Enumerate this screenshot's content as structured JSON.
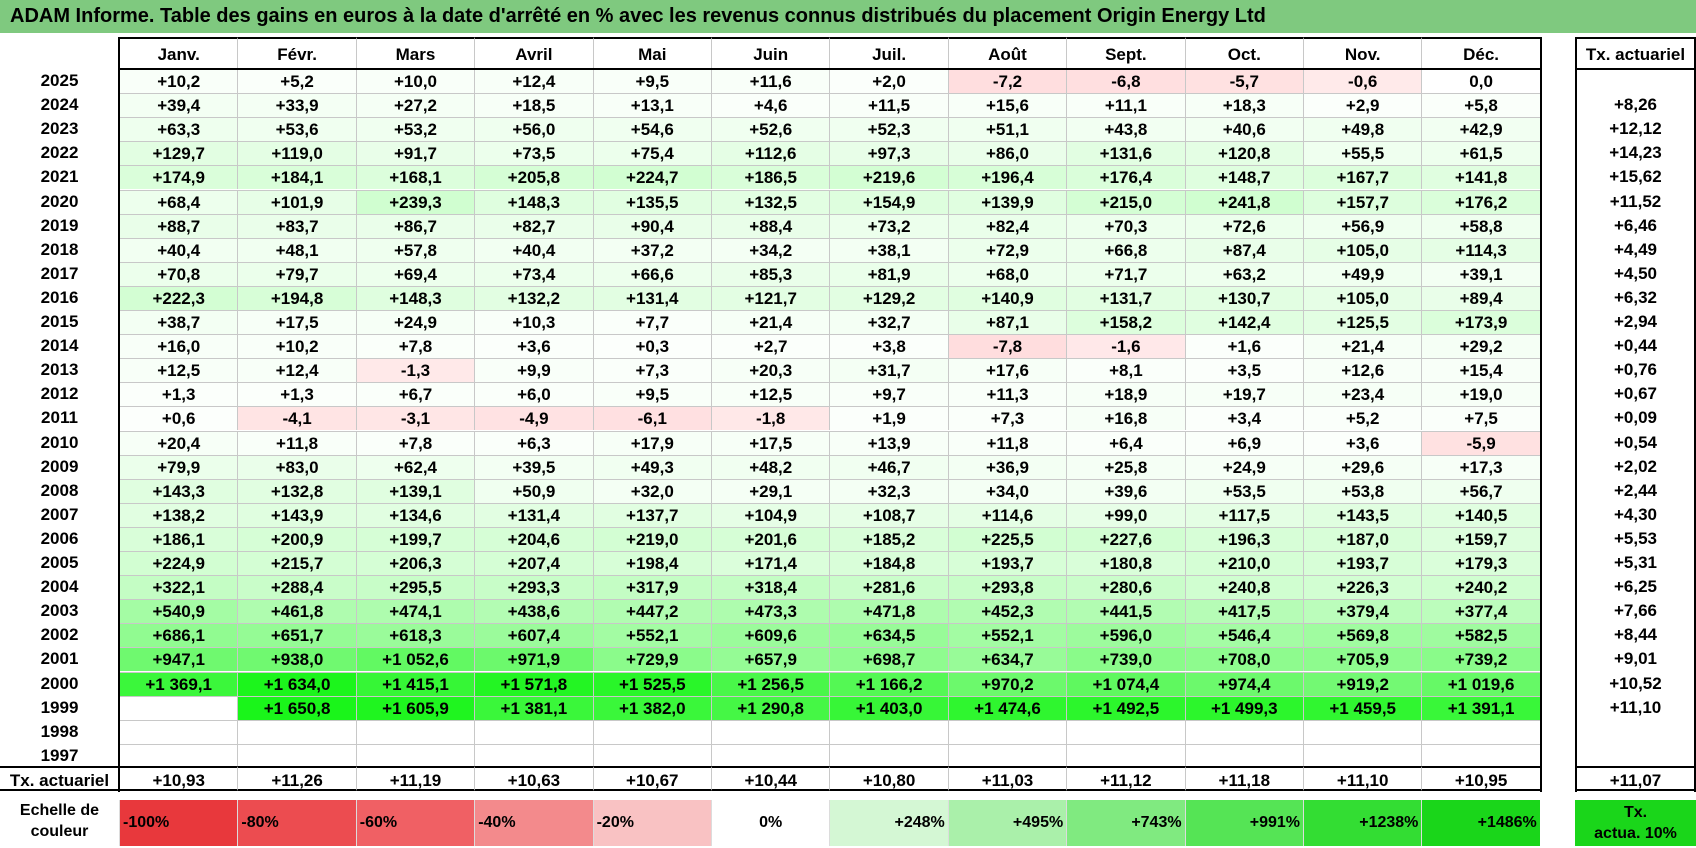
{
  "title": "ADAM Informe. Table des gains en euros à la date d'arrêté en % avec les revenus connus distribués du placement Origin Energy Ltd",
  "chart_data": {
    "type": "table",
    "months": [
      "Janv.",
      "Févr.",
      "Mars",
      "Avril",
      "Mai",
      "Juin",
      "Juil.",
      "Août",
      "Sept.",
      "Oct.",
      "Nov.",
      "Déc."
    ],
    "rate_header": "Tx. actuariel",
    "rows": [
      {
        "year": "2025",
        "values": [
          "+10,2",
          "+5,2",
          "+10,0",
          "+12,4",
          "+9,5",
          "+11,6",
          "+2,0",
          "-7,2",
          "-6,8",
          "-5,7",
          "-0,6",
          "0,0"
        ],
        "rate": ""
      },
      {
        "year": "2024",
        "values": [
          "+39,4",
          "+33,9",
          "+27,2",
          "+18,5",
          "+13,1",
          "+4,6",
          "+11,5",
          "+15,6",
          "+11,1",
          "+18,3",
          "+2,9",
          "+5,8"
        ],
        "rate": "+8,26"
      },
      {
        "year": "2023",
        "values": [
          "+63,3",
          "+53,6",
          "+53,2",
          "+56,0",
          "+54,6",
          "+52,6",
          "+52,3",
          "+51,1",
          "+43,8",
          "+40,6",
          "+49,8",
          "+42,9"
        ],
        "rate": "+12,12"
      },
      {
        "year": "2022",
        "values": [
          "+129,7",
          "+119,0",
          "+91,7",
          "+73,5",
          "+75,4",
          "+112,6",
          "+97,3",
          "+86,0",
          "+131,6",
          "+120,8",
          "+55,5",
          "+61,5"
        ],
        "rate": "+14,23"
      },
      {
        "year": "2021",
        "values": [
          "+174,9",
          "+184,1",
          "+168,1",
          "+205,8",
          "+224,7",
          "+186,5",
          "+219,6",
          "+196,4",
          "+176,4",
          "+148,7",
          "+167,7",
          "+141,8"
        ],
        "rate": "+15,62"
      },
      {
        "year": "2020",
        "values": [
          "+68,4",
          "+101,9",
          "+239,3",
          "+148,3",
          "+135,5",
          "+132,5",
          "+154,9",
          "+139,9",
          "+215,0",
          "+241,8",
          "+157,7",
          "+176,2"
        ],
        "rate": "+11,52"
      },
      {
        "year": "2019",
        "values": [
          "+88,7",
          "+83,7",
          "+86,7",
          "+82,7",
          "+90,4",
          "+88,4",
          "+73,2",
          "+82,4",
          "+70,3",
          "+72,6",
          "+56,9",
          "+58,8"
        ],
        "rate": "+6,46"
      },
      {
        "year": "2018",
        "values": [
          "+40,4",
          "+48,1",
          "+57,8",
          "+40,4",
          "+37,2",
          "+34,2",
          "+38,1",
          "+72,9",
          "+66,8",
          "+87,4",
          "+105,0",
          "+114,3"
        ],
        "rate": "+4,49"
      },
      {
        "year": "2017",
        "values": [
          "+70,8",
          "+79,7",
          "+69,4",
          "+73,4",
          "+66,6",
          "+85,3",
          "+81,9",
          "+68,0",
          "+71,7",
          "+63,2",
          "+49,9",
          "+39,1"
        ],
        "rate": "+4,50"
      },
      {
        "year": "2016",
        "values": [
          "+222,3",
          "+194,8",
          "+148,3",
          "+132,2",
          "+131,4",
          "+121,7",
          "+129,2",
          "+140,9",
          "+131,7",
          "+130,7",
          "+105,0",
          "+89,4"
        ],
        "rate": "+6,32"
      },
      {
        "year": "2015",
        "values": [
          "+38,7",
          "+17,5",
          "+24,9",
          "+10,3",
          "+7,7",
          "+21,4",
          "+32,7",
          "+87,1",
          "+158,2",
          "+142,4",
          "+125,5",
          "+173,9"
        ],
        "rate": "+2,94"
      },
      {
        "year": "2014",
        "values": [
          "+16,0",
          "+10,2",
          "+7,8",
          "+3,6",
          "+0,3",
          "+2,7",
          "+3,8",
          "-7,8",
          "-1,6",
          "+1,6",
          "+21,4",
          "+29,2"
        ],
        "rate": "+0,44"
      },
      {
        "year": "2013",
        "values": [
          "+12,5",
          "+12,4",
          "-1,3",
          "+9,9",
          "+7,3",
          "+20,3",
          "+31,7",
          "+17,6",
          "+8,1",
          "+3,5",
          "+12,6",
          "+15,4"
        ],
        "rate": "+0,76"
      },
      {
        "year": "2012",
        "values": [
          "+1,3",
          "+1,3",
          "+6,7",
          "+6,0",
          "+9,5",
          "+12,5",
          "+9,7",
          "+11,3",
          "+18,9",
          "+19,7",
          "+23,4",
          "+19,0"
        ],
        "rate": "+0,67"
      },
      {
        "year": "2011",
        "values": [
          "+0,6",
          "-4,1",
          "-3,1",
          "-4,9",
          "-6,1",
          "-1,8",
          "+1,9",
          "+7,3",
          "+16,8",
          "+3,4",
          "+5,2",
          "+7,5"
        ],
        "rate": "+0,09"
      },
      {
        "year": "2010",
        "values": [
          "+20,4",
          "+11,8",
          "+7,8",
          "+6,3",
          "+17,9",
          "+17,5",
          "+13,9",
          "+11,8",
          "+6,4",
          "+6,9",
          "+3,6",
          "-5,9"
        ],
        "rate": "+0,54"
      },
      {
        "year": "2009",
        "values": [
          "+79,9",
          "+83,0",
          "+62,4",
          "+39,5",
          "+49,3",
          "+48,2",
          "+46,7",
          "+36,9",
          "+25,8",
          "+24,9",
          "+29,6",
          "+17,3"
        ],
        "rate": "+2,02"
      },
      {
        "year": "2008",
        "values": [
          "+143,3",
          "+132,8",
          "+139,1",
          "+50,9",
          "+32,0",
          "+29,1",
          "+32,3",
          "+34,0",
          "+39,6",
          "+53,5",
          "+53,8",
          "+56,7"
        ],
        "rate": "+2,44"
      },
      {
        "year": "2007",
        "values": [
          "+138,2",
          "+143,9",
          "+134,6",
          "+131,4",
          "+137,7",
          "+104,9",
          "+108,7",
          "+114,6",
          "+99,0",
          "+117,5",
          "+143,5",
          "+140,5"
        ],
        "rate": "+4,30"
      },
      {
        "year": "2006",
        "values": [
          "+186,1",
          "+200,9",
          "+199,7",
          "+204,6",
          "+219,0",
          "+201,6",
          "+185,2",
          "+225,5",
          "+227,6",
          "+196,3",
          "+187,0",
          "+159,7"
        ],
        "rate": "+5,53"
      },
      {
        "year": "2005",
        "values": [
          "+224,9",
          "+215,7",
          "+206,3",
          "+207,4",
          "+198,4",
          "+171,4",
          "+184,8",
          "+193,7",
          "+180,8",
          "+210,0",
          "+193,7",
          "+179,3"
        ],
        "rate": "+5,31"
      },
      {
        "year": "2004",
        "values": [
          "+322,1",
          "+288,4",
          "+295,5",
          "+293,3",
          "+317,9",
          "+318,4",
          "+281,6",
          "+293,8",
          "+280,6",
          "+240,8",
          "+226,3",
          "+240,2"
        ],
        "rate": "+6,25"
      },
      {
        "year": "2003",
        "values": [
          "+540,9",
          "+461,8",
          "+474,1",
          "+438,6",
          "+447,2",
          "+473,3",
          "+471,8",
          "+452,3",
          "+441,5",
          "+417,5",
          "+379,4",
          "+377,4"
        ],
        "rate": "+7,66"
      },
      {
        "year": "2002",
        "values": [
          "+686,1",
          "+651,7",
          "+618,3",
          "+607,4",
          "+552,1",
          "+609,6",
          "+634,5",
          "+552,1",
          "+596,0",
          "+546,4",
          "+569,8",
          "+582,5"
        ],
        "rate": "+8,44"
      },
      {
        "year": "2001",
        "values": [
          "+947,1",
          "+938,0",
          "+1 052,6",
          "+971,9",
          "+729,9",
          "+657,9",
          "+698,7",
          "+634,7",
          "+739,0",
          "+708,0",
          "+705,9",
          "+739,2"
        ],
        "rate": "+9,01"
      },
      {
        "year": "2000",
        "values": [
          "+1 369,1",
          "+1 634,0",
          "+1 415,1",
          "+1 571,8",
          "+1 525,5",
          "+1 256,5",
          "+1 166,2",
          "+970,2",
          "+1 074,4",
          "+974,4",
          "+919,2",
          "+1 019,6"
        ],
        "rate": "+10,52"
      },
      {
        "year": "1999",
        "values": [
          "",
          "+1 650,8",
          "+1 605,9",
          "+1 381,1",
          "+1 382,0",
          "+1 290,8",
          "+1 403,0",
          "+1 474,6",
          "+1 492,5",
          "+1 499,3",
          "+1 459,5",
          "+1 391,1"
        ],
        "rate": "+11,10"
      },
      {
        "year": "1998",
        "values": [
          "",
          "",
          "",
          "",
          "",
          "",
          "",
          "",
          "",
          "",
          "",
          ""
        ],
        "rate": ""
      },
      {
        "year": "1997",
        "values": [
          "",
          "",
          "",
          "",
          "",
          "",
          "",
          "",
          "",
          "",
          "",
          ""
        ],
        "rate": ""
      }
    ],
    "footer": {
      "label": "Tx. actuariel",
      "values": [
        "+10,93",
        "+11,26",
        "+11,19",
        "+10,63",
        "+10,67",
        "+10,44",
        "+10,80",
        "+11,03",
        "+11,12",
        "+11,18",
        "+11,10",
        "+10,95"
      ],
      "rate": "+11,07"
    },
    "color_scale": {
      "label_line1": "Echelle de",
      "label_line2": "couleur",
      "steps": [
        {
          "label": "-100%",
          "color": "#e8383c"
        },
        {
          "label": "-80%",
          "color": "#ec4c50"
        },
        {
          "label": "-60%",
          "color": "#f06064"
        },
        {
          "label": "-40%",
          "color": "#f38a8c"
        },
        {
          "label": "-20%",
          "color": "#f9c2c3"
        },
        {
          "label": "0%",
          "color": "#ffffff"
        },
        {
          "label": "+248%",
          "color": "#d4f7d4"
        },
        {
          "label": "+495%",
          "color": "#aaf0aa"
        },
        {
          "label": "+743%",
          "color": "#80ea80"
        },
        {
          "label": "+991%",
          "color": "#55e455"
        },
        {
          "label": "+1238%",
          "color": "#33dd33"
        },
        {
          "label": "+1486%",
          "color": "#1ad61a"
        }
      ],
      "legend_line1": "Tx.",
      "legend_line2": "actua. 10%",
      "legend_color": "#1ad61a"
    }
  }
}
